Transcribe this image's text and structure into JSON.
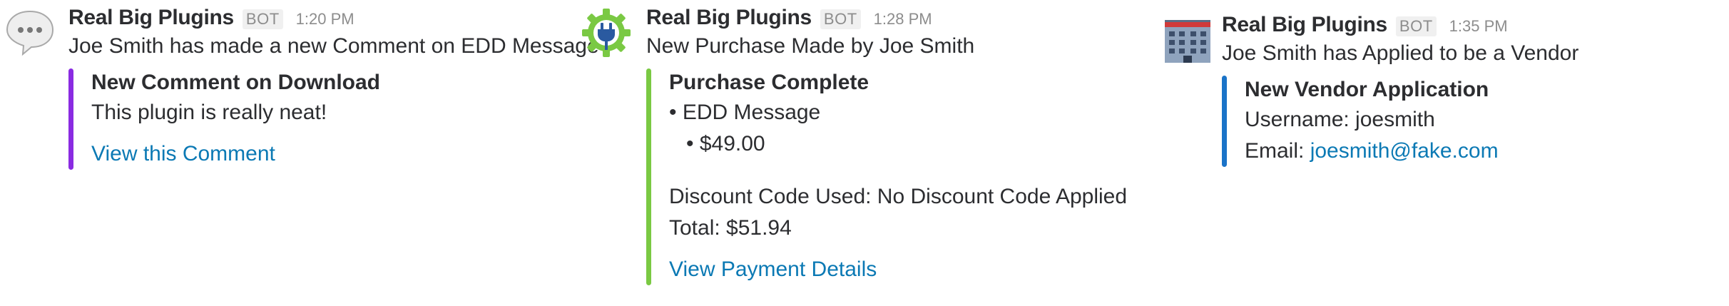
{
  "messages": [
    {
      "sender": "Real Big Plugins",
      "bot_badge": "BOT",
      "time": "1:20 PM",
      "text": "Joe Smith has made a new Comment on EDD Message",
      "avatar_icon": "speech-bubble-icon",
      "accent_color": "#8a2be2",
      "attachment": {
        "title": "New Comment on Download",
        "body": "This plugin is really neat!",
        "link": "View this Comment"
      }
    },
    {
      "sender": "Real Big Plugins",
      "bot_badge": "BOT",
      "time": "1:28 PM",
      "text": "New Purchase Made by Joe Smith",
      "avatar_icon": "plug-gear-icon",
      "accent_color": "#7ac943",
      "attachment": {
        "title": "Purchase Complete",
        "item_bullet": "• EDD Message",
        "price_bullet": "• $49.00",
        "discount": "Discount Code Used: No Discount Code Applied",
        "total": "Total: $51.94",
        "link": "View Payment Details"
      }
    },
    {
      "sender": "Real Big Plugins",
      "bot_badge": "BOT",
      "time": "1:35 PM",
      "text": "Joe Smith has Applied to be a Vendor",
      "avatar_icon": "office-building-icon",
      "accent_color": "#1a73c8",
      "attachment": {
        "title": "New Vendor Application",
        "username": "Username: joesmith",
        "email_label": "Email: ",
        "email_link": "joesmith@fake.com"
      }
    }
  ]
}
